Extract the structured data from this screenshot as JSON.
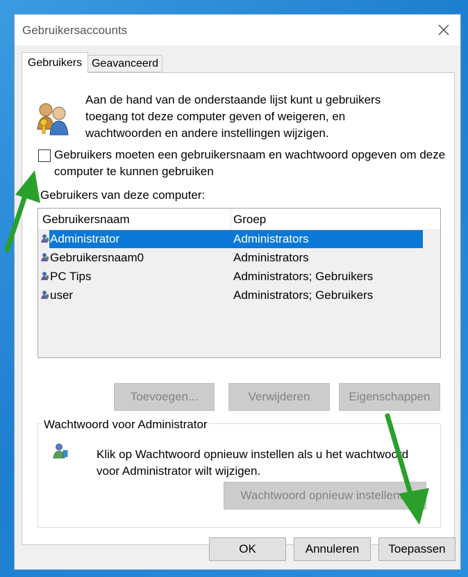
{
  "window": {
    "title": "Gebruikersaccounts"
  },
  "tabs": [
    {
      "label": "Gebruikers",
      "active": true
    },
    {
      "label": "Geavanceerd",
      "active": false
    }
  ],
  "intro": {
    "icon": "users-keys-icon",
    "text": "Aan de hand van de onderstaande lijst kunt u gebruikers toegang tot deze computer geven of weigeren, en wachtwoorden en andere instellingen wijzigen."
  },
  "require_login": {
    "checked": false,
    "label": "Gebruikers moeten een gebruikersnaam en wachtwoord opgeven om deze computer te kunnen gebruiken"
  },
  "users_section": {
    "label": "Gebruikers van deze computer:",
    "columns": [
      "Gebruikersnaam",
      "Groep"
    ],
    "rows": [
      {
        "name": "Administrator",
        "group": "Administrators",
        "selected": true
      },
      {
        "name": "Gebruikersnaam0",
        "group": "Administrators",
        "selected": false
      },
      {
        "name": "PC Tips",
        "group": "Administrators; Gebruikers",
        "selected": false
      },
      {
        "name": "user",
        "group": "Administrators; Gebruikers",
        "selected": false
      }
    ]
  },
  "user_buttons": {
    "add": "Toevoegen...",
    "remove": "Verwijderen",
    "properties": "Eigenschappen"
  },
  "password_group": {
    "title": "Wachtwoord voor Administrator",
    "text": "Klik op Wachtwoord opnieuw instellen als u het wachtwoord voor Administrator wilt wijzigen.",
    "reset_button": "Wachtwoord opnieuw instellen..."
  },
  "footer": {
    "ok": "OK",
    "cancel": "Annuleren",
    "apply": "Toepassen"
  },
  "colors": {
    "selection": "#0b78d7",
    "annotation_arrow": "#2aa02a",
    "desktop": "#1e7fd0"
  }
}
